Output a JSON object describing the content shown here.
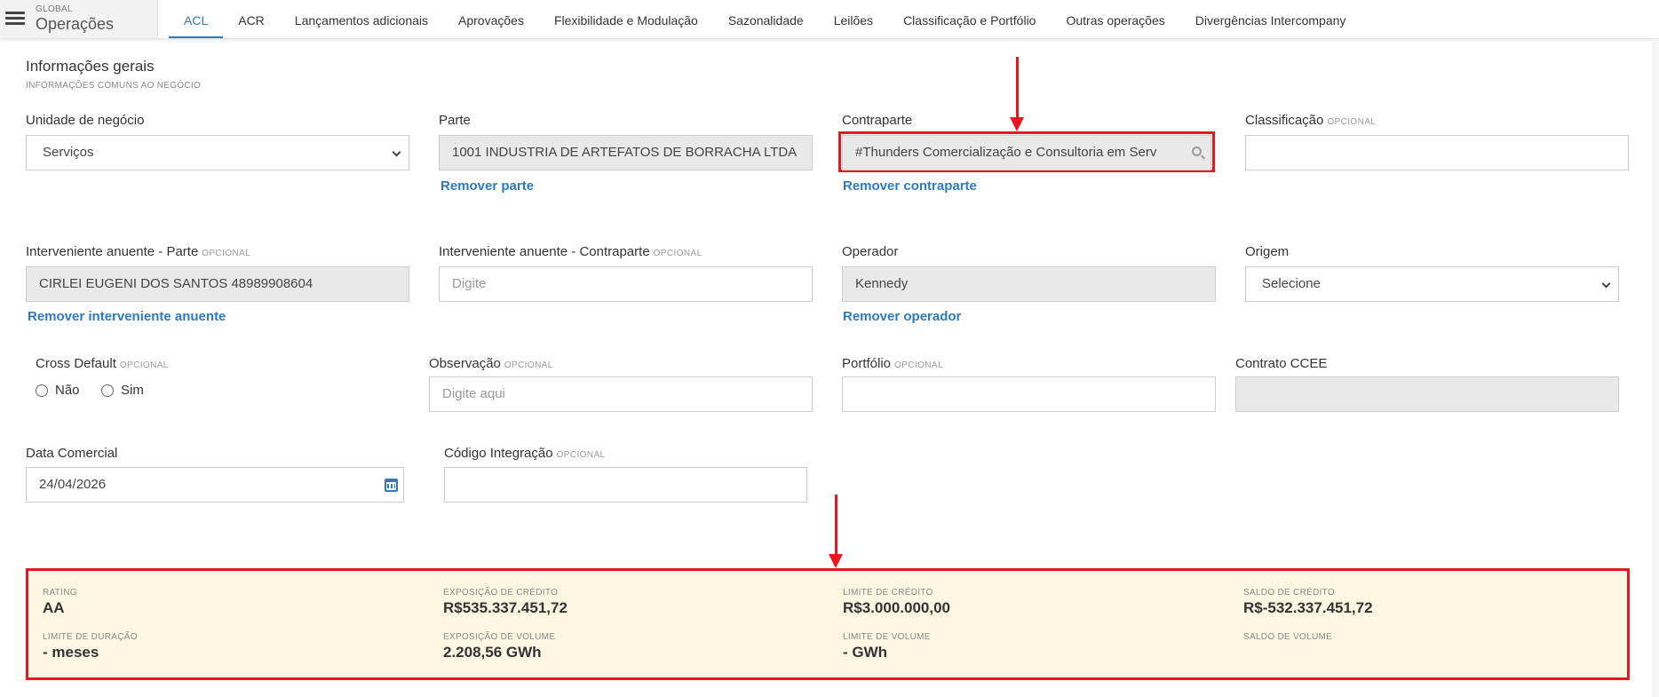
{
  "header": {
    "brand_small": "GLOBAL",
    "brand_title": "Operações",
    "tabs": [
      {
        "label": "ACL",
        "active": true
      },
      {
        "label": "ACR"
      },
      {
        "label": "Lançamentos adicionais"
      },
      {
        "label": "Aprovações"
      },
      {
        "label": "Flexibilidade e Modulação"
      },
      {
        "label": "Sazonalidade"
      },
      {
        "label": "Leilões"
      },
      {
        "label": "Classificação e Portfólio"
      },
      {
        "label": "Outras operações"
      },
      {
        "label": "Divergências Intercompany"
      }
    ]
  },
  "section": {
    "title": "Informações gerais",
    "subtitle": "INFORMAÇÕES COMUNS AO NEGÓCIO"
  },
  "optional_tag": "OPCIONAL",
  "form": {
    "unidade_label": "Unidade de negócio",
    "unidade_value": "Serviços",
    "parte_label": "Parte",
    "parte_value": "1001 INDUSTRIA DE ARTEFATOS DE BORRACHA LTDA",
    "remover_parte": "Remover parte",
    "contraparte_label": "Contraparte",
    "contraparte_value": "#Thunders Comercialização e Consultoria em Serv",
    "remover_contraparte": "Remover contraparte",
    "classificacao_label": "Classificação",
    "interv_parte_label": "Interveniente anuente - Parte",
    "interv_parte_value": "CIRLEI EUGENI DOS SANTOS 48989908604",
    "remover_interveniente": "Remover interveniente anuente",
    "interv_contraparte_label": "Interveniente anuente - Contraparte",
    "interv_contraparte_placeholder": "Digite",
    "operador_label": "Operador",
    "operador_value": "Kennedy",
    "remover_operador": "Remover operador",
    "origem_label": "Origem",
    "origem_value": "Selecione",
    "cross_default_label": "Cross Default",
    "cross_no": "Não",
    "cross_yes": "Sim",
    "observacao_label": "Observação",
    "observacao_placeholder": "Digite aqui",
    "portfolio_label": "Portfólio",
    "contrato_ccee_label": "Contrato CCEE",
    "data_comercial_label": "Data Comercial",
    "data_comercial_value": "24/04/2026",
    "codigo_integracao_label": "Código Integração"
  },
  "credit": {
    "rating_label": "RATING",
    "rating_value": "AA",
    "exposicao_credito_label": "EXPOSIÇÃO DE CRÉDITO",
    "exposicao_credito_value": "R$535.337.451,72",
    "limite_credito_label": "LIMITE DE CRÉDITO",
    "limite_credito_value": "R$3.000.000,00",
    "saldo_credito_label": "SALDO DE CRÉDITO",
    "saldo_credito_value": "R$-532.337.451,72",
    "limite_duracao_label": "LIMITE DE DURAÇÃO",
    "limite_duracao_value": "- meses",
    "exposicao_volume_label": "EXPOSIÇÃO DE VOLUME",
    "exposicao_volume_value": "2.208,56 GWh",
    "limite_volume_label": "LIMITE DE VOLUME",
    "limite_volume_value": "- GWh",
    "saldo_volume_label": "SALDO DE VOLUME",
    "saldo_volume_value": ""
  },
  "colors": {
    "accent": "#2f7abf",
    "highlight": "#e8161f",
    "credit_bg": "#fcf6e2"
  }
}
